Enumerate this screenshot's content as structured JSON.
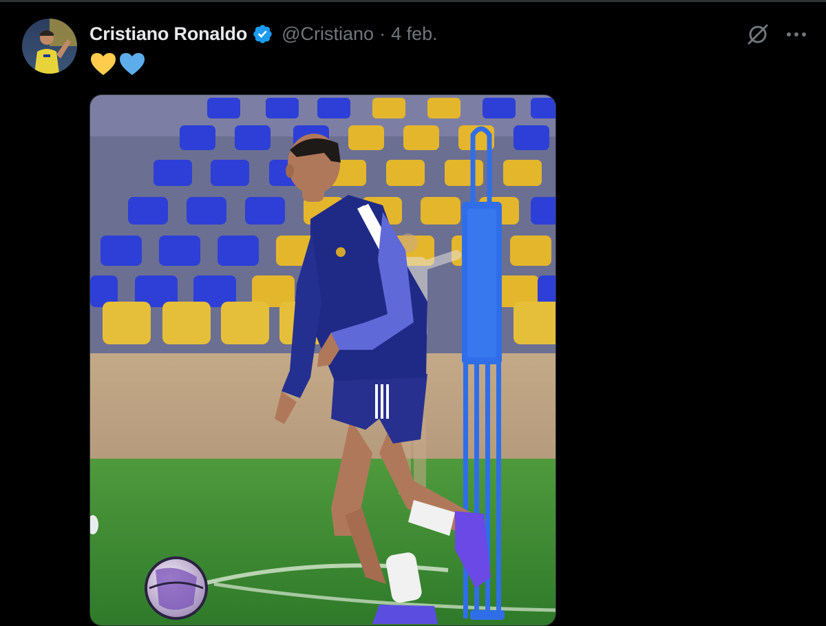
{
  "post": {
    "author": {
      "display_name": "Cristiano Ronaldo",
      "handle": "@Cristiano",
      "verified": true,
      "verified_color": "#1d9bf0"
    },
    "separator": "·",
    "date": "4 feb.",
    "text_emojis": [
      {
        "name": "yellow-heart",
        "color": "#ffcc4d"
      },
      {
        "name": "blue-heart",
        "color": "#5dadec"
      }
    ],
    "media": {
      "type": "photo",
      "description_icon": "image"
    },
    "actions": {
      "grok_icon": "grok-icon",
      "more_icon": "more-icon"
    }
  },
  "theme": {
    "background": "#000000",
    "text_primary": "#e7e9ea",
    "text_secondary": "#71767b",
    "border": "#2f3336"
  }
}
